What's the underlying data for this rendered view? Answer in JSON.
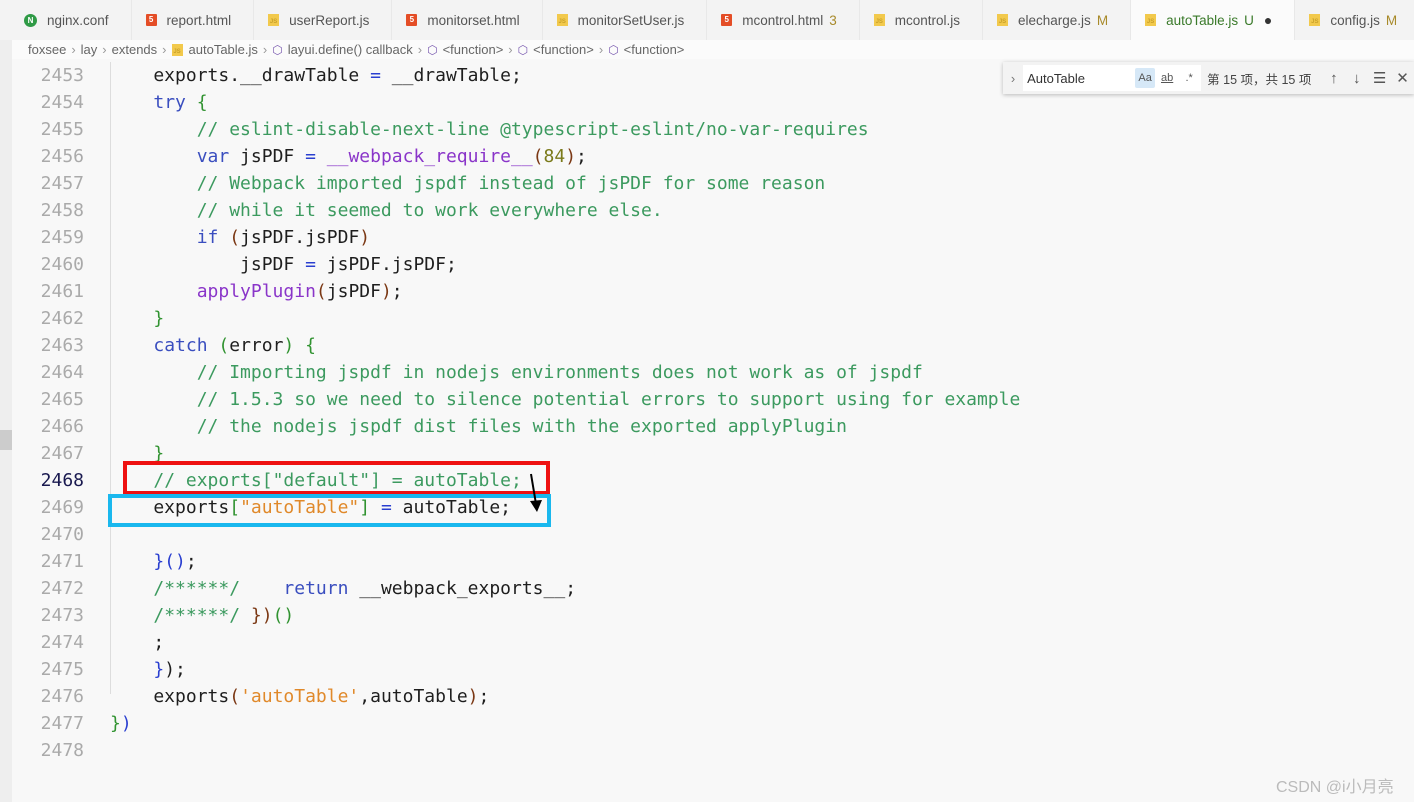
{
  "tabs": [
    {
      "label": "nginx.conf",
      "icon": "nginx-icon",
      "badge": ""
    },
    {
      "label": "report.html",
      "icon": "html5-icon",
      "badge": ""
    },
    {
      "label": "userReport.js",
      "icon": "js-icon",
      "badge": ""
    },
    {
      "label": "monitorset.html",
      "icon": "html5-icon",
      "badge": ""
    },
    {
      "label": "monitorSetUser.js",
      "icon": "js-icon",
      "badge": ""
    },
    {
      "label": "mcontrol.html",
      "icon": "html5-icon",
      "badge": "3"
    },
    {
      "label": "mcontrol.js",
      "icon": "js-icon",
      "badge": ""
    },
    {
      "label": "elecharge.js",
      "icon": "js-icon",
      "badge": "M"
    },
    {
      "label": "autoTable.js",
      "icon": "js-icon",
      "badge": "U",
      "active": true,
      "dirty": "●"
    },
    {
      "label": "config.js",
      "icon": "js-icon",
      "badge": "M"
    },
    {
      "label": "",
      "icon": "html5-icon",
      "badge": ""
    }
  ],
  "breadcrumb": [
    "foxsee",
    "lay",
    "extends",
    "autoTable.js",
    "layui.define() callback",
    "<function>",
    "<function>",
    "<function>"
  ],
  "find": {
    "query": "AutoTable",
    "match_case": "Aa",
    "whole_word": "ab",
    "regex": ".*",
    "count": "第 15 项，共 15 项",
    "prev": "↑",
    "next": "↓",
    "selection": "☰",
    "close": "✕"
  },
  "colors": {
    "kw": "#3a4ebf",
    "cm": "#3c9a5f",
    "str": "#e0892a",
    "fn": "#8a35c9",
    "num": "#7a7a1a",
    "op": "#2a3fd0",
    "b1": "#2a3fd0",
    "b2": "#319331",
    "b3": "#7b3814",
    "txt": "#1e1e1e",
    "red_box": "#ee1111",
    "blue_box": "#1ab8ee"
  },
  "active_line": 2468,
  "lines": [
    {
      "n": 2453,
      "t": [
        [
          "txt",
          "    exports.__drawTable "
        ],
        [
          "op",
          "="
        ],
        [
          "txt",
          " __drawTable;"
        ]
      ]
    },
    {
      "n": 2454,
      "t": [
        [
          "txt",
          "    "
        ],
        [
          "kw",
          "try"
        ],
        [
          "txt",
          " "
        ],
        [
          "b2",
          "{"
        ]
      ]
    },
    {
      "n": 2455,
      "t": [
        [
          "txt",
          "        "
        ],
        [
          "cm",
          "// eslint-disable-next-line @typescript-eslint/no-var-requires"
        ]
      ]
    },
    {
      "n": 2456,
      "t": [
        [
          "txt",
          "        "
        ],
        [
          "kw",
          "var"
        ],
        [
          "txt",
          " jsPDF "
        ],
        [
          "op",
          "="
        ],
        [
          "txt",
          " "
        ],
        [
          "fn",
          "__webpack_require__"
        ],
        [
          "b3",
          "("
        ],
        [
          "num",
          "84"
        ],
        [
          "b3",
          ")"
        ],
        [
          "txt",
          ";"
        ]
      ]
    },
    {
      "n": 2457,
      "t": [
        [
          "txt",
          "        "
        ],
        [
          "cm",
          "// Webpack imported jspdf instead of jsPDF for some reason"
        ]
      ]
    },
    {
      "n": 2458,
      "t": [
        [
          "txt",
          "        "
        ],
        [
          "cm",
          "// while it seemed to work everywhere else."
        ]
      ]
    },
    {
      "n": 2459,
      "t": [
        [
          "txt",
          "        "
        ],
        [
          "kw",
          "if"
        ],
        [
          "txt",
          " "
        ],
        [
          "b3",
          "("
        ],
        [
          "txt",
          "jsPDF.jsPDF"
        ],
        [
          "b3",
          ")"
        ]
      ]
    },
    {
      "n": 2460,
      "t": [
        [
          "txt",
          "            jsPDF "
        ],
        [
          "op",
          "="
        ],
        [
          "txt",
          " jsPDF.jsPDF;"
        ]
      ]
    },
    {
      "n": 2461,
      "t": [
        [
          "txt",
          "        "
        ],
        [
          "fn",
          "applyPlugin"
        ],
        [
          "b3",
          "("
        ],
        [
          "txt",
          "jsPDF"
        ],
        [
          "b3",
          ")"
        ],
        [
          "txt",
          ";"
        ]
      ]
    },
    {
      "n": 2462,
      "t": [
        [
          "txt",
          "    "
        ],
        [
          "b2",
          "}"
        ]
      ]
    },
    {
      "n": 2463,
      "t": [
        [
          "txt",
          "    "
        ],
        [
          "kw",
          "catch"
        ],
        [
          "txt",
          " "
        ],
        [
          "b2",
          "("
        ],
        [
          "txt",
          "error"
        ],
        [
          "b2",
          ")"
        ],
        [
          "txt",
          " "
        ],
        [
          "b2",
          "{"
        ]
      ]
    },
    {
      "n": 2464,
      "t": [
        [
          "txt",
          "        "
        ],
        [
          "cm",
          "// Importing jspdf in nodejs environments does not work as of jspdf"
        ]
      ]
    },
    {
      "n": 2465,
      "t": [
        [
          "txt",
          "        "
        ],
        [
          "cm",
          "// 1.5.3 so we need to silence potential errors to support using for example"
        ]
      ]
    },
    {
      "n": 2466,
      "t": [
        [
          "txt",
          "        "
        ],
        [
          "cm",
          "// the nodejs jspdf dist files with the exported applyPlugin"
        ]
      ]
    },
    {
      "n": 2467,
      "t": [
        [
          "txt",
          "    "
        ],
        [
          "b2",
          "}"
        ]
      ]
    },
    {
      "n": 2468,
      "t": [
        [
          "txt",
          "    "
        ],
        [
          "cm",
          "// exports[\"default\"] = autoTable;"
        ]
      ]
    },
    {
      "n": 2469,
      "t": [
        [
          "txt",
          "    exports"
        ],
        [
          "b2",
          "["
        ],
        [
          "str",
          "\"autoTable\""
        ],
        [
          "b2",
          "]"
        ],
        [
          "txt",
          " "
        ],
        [
          "op",
          "="
        ],
        [
          "txt",
          " autoTable;"
        ]
      ]
    },
    {
      "n": 2470,
      "t": []
    },
    {
      "n": 2471,
      "t": [
        [
          "txt",
          "    "
        ],
        [
          "b1",
          "}()"
        ],
        [
          "txt",
          ";"
        ]
      ]
    },
    {
      "n": 2472,
      "t": [
        [
          "txt",
          "    "
        ],
        [
          "cm",
          "/******/"
        ],
        [
          "txt",
          "    "
        ],
        [
          "kw",
          "return"
        ],
        [
          "txt",
          " __webpack_exports__;"
        ]
      ]
    },
    {
      "n": 2473,
      "t": [
        [
          "txt",
          "    "
        ],
        [
          "cm",
          "/******/"
        ],
        [
          "txt",
          " "
        ],
        [
          "b3",
          "})"
        ],
        [
          "b2",
          "()"
        ]
      ]
    },
    {
      "n": 2474,
      "t": [
        [
          "txt",
          "    ;"
        ]
      ]
    },
    {
      "n": 2475,
      "t": [
        [
          "txt",
          "    "
        ],
        [
          "b1",
          "}"
        ],
        [
          "txt",
          ");"
        ]
      ]
    },
    {
      "n": 2476,
      "t": [
        [
          "txt",
          "    exports"
        ],
        [
          "b3",
          "("
        ],
        [
          "str",
          "'autoTable'"
        ],
        [
          "txt",
          ",autoTable"
        ],
        [
          "b3",
          ")"
        ],
        [
          "txt",
          ";"
        ]
      ]
    },
    {
      "n": 2477,
      "t": [
        [
          "b2",
          "}"
        ],
        [
          "b1",
          ")"
        ]
      ]
    },
    {
      "n": 2478,
      "t": []
    }
  ],
  "watermark": "CSDN @i小月亮"
}
